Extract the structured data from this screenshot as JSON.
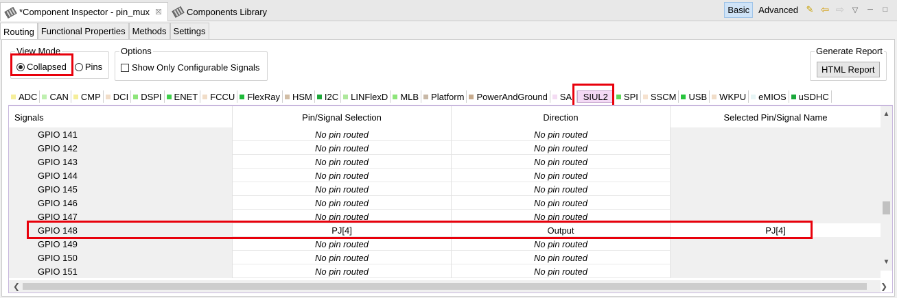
{
  "editor_tabs": {
    "active": {
      "label": "*Component Inspector - pin_mux",
      "close": "☒"
    },
    "inactive": {
      "label": "Components Library"
    }
  },
  "toolbar": {
    "basic": "Basic",
    "advanced": "Advanced"
  },
  "subtabs": [
    "Routing",
    "Functional Properties",
    "Methods",
    "Settings"
  ],
  "view_mode": {
    "title": "View Mode",
    "collapsed": "Collapsed",
    "pins": "Pins"
  },
  "options": {
    "title": "Options",
    "show_only": "Show Only Configurable Signals"
  },
  "report": {
    "title": "Generate Report",
    "button": "HTML Report"
  },
  "categories": [
    {
      "label": "ADC",
      "color": "#f5ee9a"
    },
    {
      "label": "CAN",
      "color": "#bff0b0"
    },
    {
      "label": "CMP",
      "color": "#f5ee9a"
    },
    {
      "label": "DCI",
      "color": "#f1ddc8"
    },
    {
      "label": "DSPI",
      "color": "#8ee57a"
    },
    {
      "label": "ENET",
      "color": "#3fd04a"
    },
    {
      "label": "FCCU",
      "color": "#f1ddc8"
    },
    {
      "label": "FlexRay",
      "color": "#1fba3a"
    },
    {
      "label": "HSM",
      "color": "#d2bea6"
    },
    {
      "label": "I2C",
      "color": "#1ea83a"
    },
    {
      "label": "LINFlexD",
      "color": "#aee89c"
    },
    {
      "label": "MLB",
      "color": "#8ee57a"
    },
    {
      "label": "Platform",
      "color": "#c8b8a6"
    },
    {
      "label": "PowerAndGround",
      "color": "#c7ab8d"
    },
    {
      "label": "SAI",
      "color": "#f4dcf3"
    },
    {
      "label": "SIUL2",
      "color": "#f3d9f5"
    },
    {
      "label": "SPI",
      "color": "#5fd65a"
    },
    {
      "label": "SSCM",
      "color": "#f6e2cf"
    },
    {
      "label": "USB",
      "color": "#27c43c"
    },
    {
      "label": "WKPU",
      "color": "#f1ddc8"
    },
    {
      "label": "eMIOS",
      "color": "#e6f5f5"
    },
    {
      "label": "uSDHC",
      "color": "#1aa83a"
    }
  ],
  "table": {
    "headers": [
      "Signals",
      "Pin/Signal Selection",
      "Direction",
      "Selected Pin/Signal Name"
    ],
    "rows": [
      {
        "signal": "GPIO 141",
        "pin": "No pin routed",
        "dir": "No pin routed",
        "name": ""
      },
      {
        "signal": "GPIO 142",
        "pin": "No pin routed",
        "dir": "No pin routed",
        "name": ""
      },
      {
        "signal": "GPIO 143",
        "pin": "No pin routed",
        "dir": "No pin routed",
        "name": ""
      },
      {
        "signal": "GPIO 144",
        "pin": "No pin routed",
        "dir": "No pin routed",
        "name": ""
      },
      {
        "signal": "GPIO 145",
        "pin": "No pin routed",
        "dir": "No pin routed",
        "name": ""
      },
      {
        "signal": "GPIO 146",
        "pin": "No pin routed",
        "dir": "No pin routed",
        "name": ""
      },
      {
        "signal": "GPIO 147",
        "pin": "No pin routed",
        "dir": "No pin routed",
        "name": ""
      },
      {
        "signal": "GPIO 148",
        "pin": "PJ[4]",
        "dir": "Output",
        "name": "PJ[4]"
      },
      {
        "signal": "GPIO 149",
        "pin": "No pin routed",
        "dir": "No pin routed",
        "name": ""
      },
      {
        "signal": "GPIO 150",
        "pin": "No pin routed",
        "dir": "No pin routed",
        "name": ""
      },
      {
        "signal": "GPIO 151",
        "pin": "No pin routed",
        "dir": "No pin routed",
        "name": ""
      }
    ]
  },
  "highlight_color": "#e8000b"
}
